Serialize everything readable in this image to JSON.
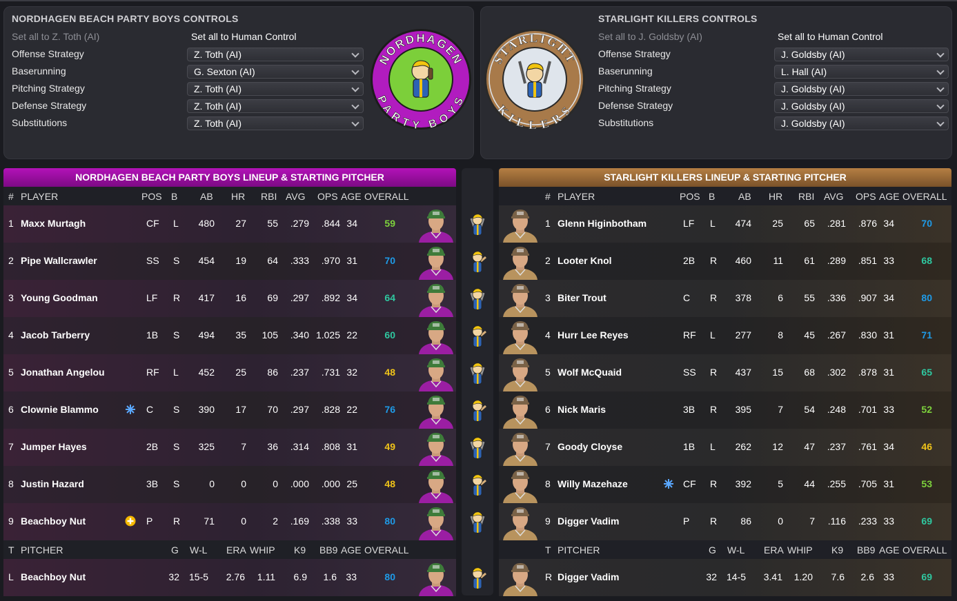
{
  "home_controls": {
    "title": "NORDHAGEN BEACH PARTY BOYS CONTROLS",
    "set_all_ai": "Set all to Z. Toth (AI)",
    "set_all_human": "Set all to Human Control",
    "rows": [
      {
        "label": "Offense Strategy",
        "value": "Z. Toth (AI)"
      },
      {
        "label": "Baserunning",
        "value": "G. Sexton (AI)"
      },
      {
        "label": "Pitching Strategy",
        "value": "Z. Toth (AI)"
      },
      {
        "label": "Defense Strategy",
        "value": "Z. Toth (AI)"
      },
      {
        "label": "Substitutions",
        "value": "Z. Toth (AI)"
      }
    ],
    "logo": {
      "top_text": "NORDHAGEN",
      "bottom_text": "PARTY BOYS",
      "ring_color": "#b11cbf",
      "center_color": "#7ccf3a"
    }
  },
  "away_controls": {
    "title": "STARLIGHT KILLERS CONTROLS",
    "set_all_ai": "Set all to J. Goldsby (AI)",
    "set_all_human": "Set all to Human Control",
    "rows": [
      {
        "label": "Offense Strategy",
        "value": "J. Goldsby (AI)"
      },
      {
        "label": "Baserunning",
        "value": "L. Hall (AI)"
      },
      {
        "label": "Pitching Strategy",
        "value": "J. Goldsby (AI)"
      },
      {
        "label": "Defense Strategy",
        "value": "J. Goldsby (AI)"
      },
      {
        "label": "Substitutions",
        "value": "J. Goldsby (AI)"
      }
    ],
    "logo": {
      "top_text": "STARLIGHT",
      "bottom_text": "KILLERS",
      "ring_color": "#a87a4a",
      "center_color": "#dfe5ec"
    }
  },
  "batting_columns": {
    "num": "#",
    "player": "PLAYER",
    "pos": "POS",
    "b": "B",
    "ab": "AB",
    "hr": "HR",
    "rbi": "RBI",
    "avg": "AVG",
    "ops": "OPS",
    "age": "AGE",
    "overall": "OVERALL"
  },
  "pitching_columns": {
    "t": "T",
    "pitcher": "PITCHER",
    "g": "G",
    "wl": "W-L",
    "era": "ERA",
    "whip": "WHIP",
    "k9": "K9",
    "bb9": "BB9",
    "age": "AGE",
    "overall": "OVERALL"
  },
  "home_lineup": {
    "header": "NORDHAGEN BEACH PARTY BOYS LINEUP & STARTING PITCHER",
    "players": [
      {
        "num": "1",
        "name": "Maxx Murtagh",
        "pos": "CF",
        "b": "L",
        "ab": "480",
        "hr": "27",
        "rbi": "55",
        "avg": ".279",
        "ops": ".844",
        "age": "34",
        "overall": "59",
        "overall_color": "#7dd23c",
        "badge": ""
      },
      {
        "num": "2",
        "name": "Pipe Wallcrawler",
        "pos": "SS",
        "b": "S",
        "ab": "454",
        "hr": "19",
        "rbi": "64",
        "avg": ".333",
        "ops": ".970",
        "age": "31",
        "overall": "70",
        "overall_color": "#1e9be8",
        "badge": ""
      },
      {
        "num": "3",
        "name": "Young Goodman",
        "pos": "LF",
        "b": "R",
        "ab": "417",
        "hr": "16",
        "rbi": "69",
        "avg": ".297",
        "ops": ".892",
        "age": "34",
        "overall": "64",
        "overall_color": "#2fc8a0",
        "badge": ""
      },
      {
        "num": "4",
        "name": "Jacob Tarberry",
        "pos": "1B",
        "b": "S",
        "ab": "494",
        "hr": "35",
        "rbi": "105",
        "avg": ".340",
        "ops": "1.025",
        "age": "22",
        "overall": "60",
        "overall_color": "#2fc8a0",
        "badge": ""
      },
      {
        "num": "5",
        "name": "Jonathan Angelou",
        "pos": "RF",
        "b": "L",
        "ab": "452",
        "hr": "25",
        "rbi": "86",
        "avg": ".237",
        "ops": ".731",
        "age": "32",
        "overall": "48",
        "overall_color": "#f0c419",
        "badge": ""
      },
      {
        "num": "6",
        "name": "Clownie Blammo",
        "pos": "C",
        "b": "S",
        "ab": "390",
        "hr": "17",
        "rbi": "70",
        "avg": ".297",
        "ops": ".828",
        "age": "22",
        "overall": "76",
        "overall_color": "#1e9be8",
        "badge": "snowflake"
      },
      {
        "num": "7",
        "name": "Jumper Hayes",
        "pos": "2B",
        "b": "S",
        "ab": "325",
        "hr": "7",
        "rbi": "36",
        "avg": ".314",
        "ops": ".808",
        "age": "31",
        "overall": "49",
        "overall_color": "#f0c419",
        "badge": ""
      },
      {
        "num": "8",
        "name": "Justin Hazard",
        "pos": "3B",
        "b": "S",
        "ab": "0",
        "hr": "0",
        "rbi": "0",
        "avg": ".000",
        "ops": ".000",
        "age": "25",
        "overall": "48",
        "overall_color": "#f0c419",
        "badge": ""
      },
      {
        "num": "9",
        "name": "Beachboy Nut",
        "pos": "P",
        "b": "R",
        "ab": "71",
        "hr": "0",
        "rbi": "2",
        "avg": ".169",
        "ops": ".338",
        "age": "33",
        "overall": "80",
        "overall_color": "#1e9be8",
        "badge": "plus"
      }
    ],
    "pitcher": {
      "t": "L",
      "name": "Beachboy Nut",
      "g": "32",
      "wl": "15-5",
      "era": "2.76",
      "whip": "1.11",
      "k9": "6.9",
      "bb9": "1.6",
      "age": "33",
      "overall": "80",
      "overall_color": "#1e9be8"
    }
  },
  "away_lineup": {
    "header": "STARLIGHT KILLERS LINEUP & STARTING PITCHER",
    "players": [
      {
        "num": "1",
        "name": "Glenn Higinbotham",
        "pos": "LF",
        "b": "L",
        "ab": "474",
        "hr": "25",
        "rbi": "65",
        "avg": ".281",
        "ops": ".876",
        "age": "34",
        "overall": "70",
        "overall_color": "#1e9be8",
        "badge": ""
      },
      {
        "num": "2",
        "name": "Looter Knol",
        "pos": "2B",
        "b": "R",
        "ab": "460",
        "hr": "11",
        "rbi": "61",
        "avg": ".289",
        "ops": ".851",
        "age": "33",
        "overall": "68",
        "overall_color": "#2fc8a0",
        "badge": ""
      },
      {
        "num": "3",
        "name": "Biter Trout",
        "pos": "C",
        "b": "R",
        "ab": "378",
        "hr": "6",
        "rbi": "55",
        "avg": ".336",
        "ops": ".907",
        "age": "34",
        "overall": "80",
        "overall_color": "#1e9be8",
        "badge": ""
      },
      {
        "num": "4",
        "name": "Hurr Lee Reyes",
        "pos": "RF",
        "b": "L",
        "ab": "277",
        "hr": "8",
        "rbi": "45",
        "avg": ".267",
        "ops": ".830",
        "age": "31",
        "overall": "71",
        "overall_color": "#1e9be8",
        "badge": ""
      },
      {
        "num": "5",
        "name": "Wolf McQuaid",
        "pos": "SS",
        "b": "R",
        "ab": "437",
        "hr": "15",
        "rbi": "68",
        "avg": ".302",
        "ops": ".878",
        "age": "31",
        "overall": "65",
        "overall_color": "#2fc8a0",
        "badge": ""
      },
      {
        "num": "6",
        "name": "Nick Maris",
        "pos": "3B",
        "b": "R",
        "ab": "395",
        "hr": "7",
        "rbi": "54",
        "avg": ".248",
        "ops": ".701",
        "age": "33",
        "overall": "52",
        "overall_color": "#7dd23c",
        "badge": ""
      },
      {
        "num": "7",
        "name": "Goody Cloyse",
        "pos": "1B",
        "b": "L",
        "ab": "262",
        "hr": "12",
        "rbi": "47",
        "avg": ".237",
        "ops": ".761",
        "age": "34",
        "overall": "46",
        "overall_color": "#f0c419",
        "badge": ""
      },
      {
        "num": "8",
        "name": "Willy Mazehaze",
        "pos": "CF",
        "b": "R",
        "ab": "392",
        "hr": "5",
        "rbi": "44",
        "avg": ".255",
        "ops": ".705",
        "age": "31",
        "overall": "53",
        "overall_color": "#7dd23c",
        "badge": "snowflake"
      },
      {
        "num": "9",
        "name": "Digger Vadim",
        "pos": "P",
        "b": "R",
        "ab": "86",
        "hr": "0",
        "rbi": "7",
        "avg": ".116",
        "ops": ".233",
        "age": "33",
        "overall": "69",
        "overall_color": "#2fc8a0",
        "badge": ""
      }
    ],
    "pitcher": {
      "t": "R",
      "name": "Digger Vadim",
      "g": "32",
      "wl": "14-5",
      "era": "3.41",
      "whip": "1.20",
      "k9": "7.6",
      "bb9": "2.6",
      "age": "33",
      "overall": "69",
      "overall_color": "#2fc8a0"
    }
  },
  "colors": {
    "home_jersey": "#9b1ea3",
    "away_jersey": "#b8935e",
    "home_cap": "#3e7b3a",
    "away_cap": "#7a6247"
  }
}
